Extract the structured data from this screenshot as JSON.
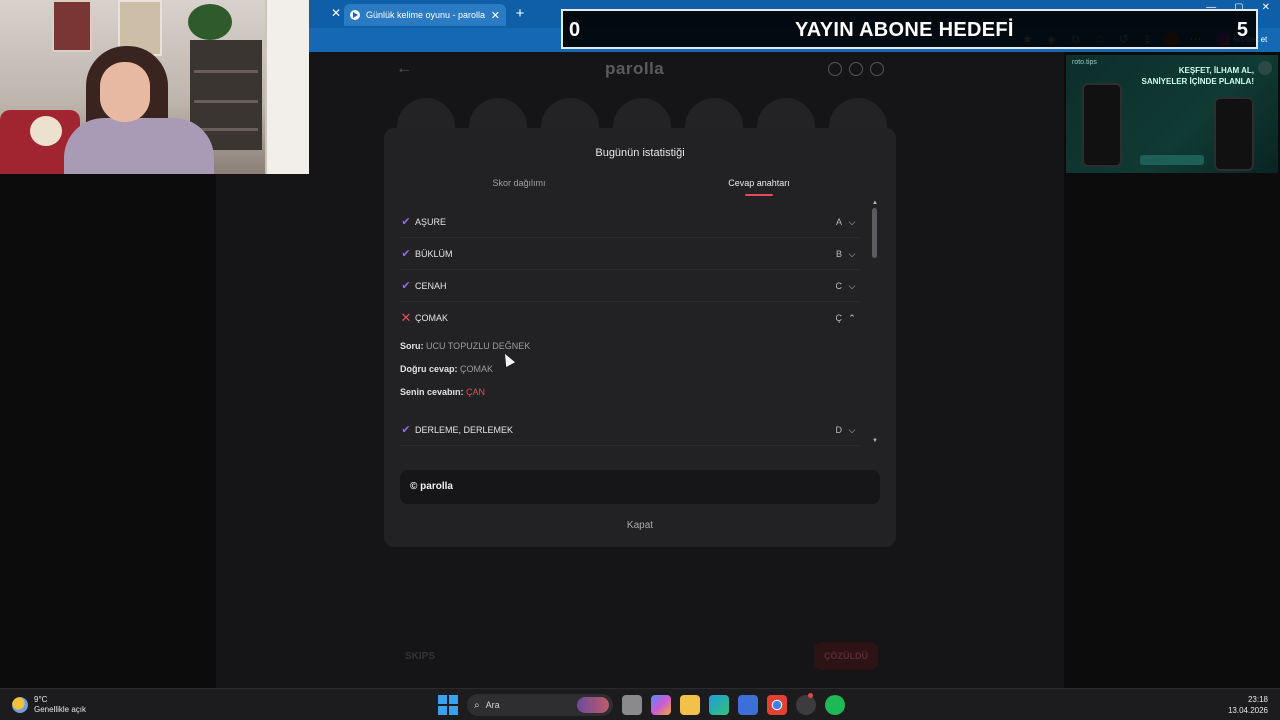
{
  "browser": {
    "tab_title": "Günlük kelime oyunu - parolla - Ke",
    "copilot_label": "Sohbet et"
  },
  "overlay": {
    "left_value": "0",
    "title": "YAYIN ABONE HEDEFİ",
    "right_value": "5"
  },
  "background_page": {
    "logo": "parolla",
    "bottom_left": "SKIPS",
    "bottom_right": "ÇÖZÜLDÜ"
  },
  "ad": {
    "brand": "roto.tips",
    "text": "KEŞFET, İLHAM AL, SANİYELER İÇİNDE PLANLA!"
  },
  "modal": {
    "title": "Bugünün istatistiği",
    "tabs": [
      {
        "label": "Skor dağılımı",
        "active": false
      },
      {
        "label": "Cevap anahtarı",
        "active": true
      }
    ],
    "answers": [
      {
        "word": "AŞURE",
        "letter": "A",
        "correct": true,
        "expanded": false
      },
      {
        "word": "BÜKLÜM",
        "letter": "B",
        "correct": true,
        "expanded": false
      },
      {
        "word": "CENAH",
        "letter": "C",
        "correct": true,
        "expanded": false
      },
      {
        "word": "ÇOMAK",
        "letter": "Ç",
        "correct": false,
        "expanded": true
      },
      {
        "word": "DERLEME, DERLEMEK",
        "letter": "D",
        "correct": true,
        "expanded": false
      }
    ],
    "detail": {
      "question_label": "Soru:",
      "question_value": "UCU TOPUZLU DEĞNEK",
      "correct_label": "Doğru cevap:",
      "correct_value": "ÇOMAK",
      "yours_label": "Senin cevabın:",
      "yours_value": "ÇAN"
    },
    "copyright": "© parolla",
    "close_label": "Kapat"
  },
  "taskbar": {
    "weather_temp": "9°C",
    "weather_desc": "Genellikle açık",
    "search_placeholder": "Ara",
    "time": "23:18",
    "date": "13.04.2026"
  },
  "colors": {
    "accent": "#e64b5c",
    "check": "#8a6de0",
    "browser_blue": "#0f5fa8"
  }
}
